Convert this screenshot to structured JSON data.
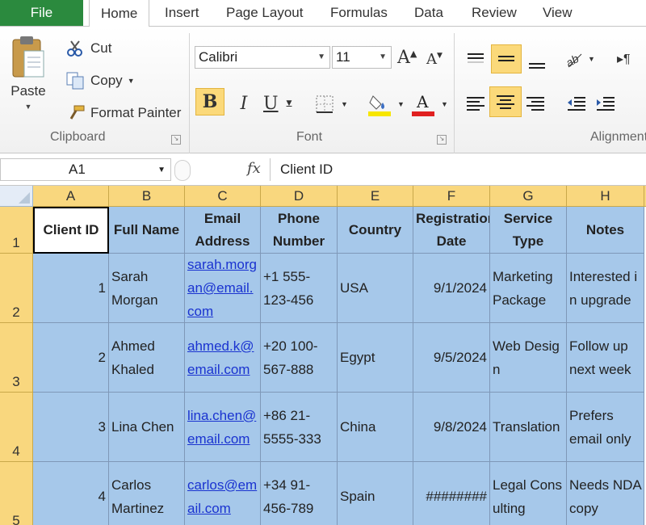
{
  "tabs": {
    "file": "File",
    "items": [
      "Home",
      "Insert",
      "Page Layout",
      "Formulas",
      "Data",
      "Review",
      "View"
    ]
  },
  "clipboard": {
    "paste": "Paste",
    "cut": "Cut",
    "copy": "Copy",
    "format_painter": "Format Painter",
    "label": "Clipboard"
  },
  "font": {
    "family": "Calibri",
    "size": "11",
    "label": "Font",
    "bold": "B",
    "italic": "I",
    "underline": "U",
    "grow": "A",
    "shrink": "A",
    "fill_color": "#f7e600",
    "text_color": "#e02020"
  },
  "alignment": {
    "label": "Alignment"
  },
  "formula_bar": {
    "name_box": "A1",
    "fx": "fx",
    "content": "Client ID"
  },
  "grid": {
    "columns": [
      "A",
      "B",
      "C",
      "D",
      "E",
      "F",
      "G",
      "H"
    ],
    "rows": [
      "1",
      "2",
      "3",
      "4",
      "5"
    ],
    "headers": [
      "Client ID",
      "Full Name",
      "Email Address",
      "Phone Number",
      "Country",
      "Registration Date",
      "Service Type",
      "Notes"
    ],
    "records": [
      {
        "id": "1",
        "name": "Sarah Morgan",
        "email": "sarah.morgan@email.com",
        "phone": "+1 555-123-456",
        "country": "USA",
        "date": "9/1/2024",
        "service": "Marketing Package",
        "notes": "Interested in upgrade"
      },
      {
        "id": "2",
        "name": "Ahmed Khaled",
        "email": "ahmed.k@email.com",
        "phone": "+20 100-567-888",
        "country": "Egypt",
        "date": "9/5/2024",
        "service": "Web Design",
        "notes": "Follow up next week"
      },
      {
        "id": "3",
        "name": "Lina Chen",
        "email": "lina.chen@email.com",
        "phone": "+86 21-5555-333",
        "country": "China",
        "date": "9/8/2024",
        "service": "Translation",
        "notes": "Prefers email only"
      },
      {
        "id": "4",
        "name": "Carlos Martinez",
        "email": "carlos@email.com",
        "phone": "+34 91-456-789",
        "country": "Spain",
        "date": "########",
        "service": "Legal Consulting",
        "notes": "Needs NDA copy"
      }
    ]
  },
  "colors": {
    "file_tab": "#2b8a3e",
    "header_fill": "#f9d77e",
    "cell_fill": "#a6c8ea",
    "link": "#1a33d0"
  }
}
